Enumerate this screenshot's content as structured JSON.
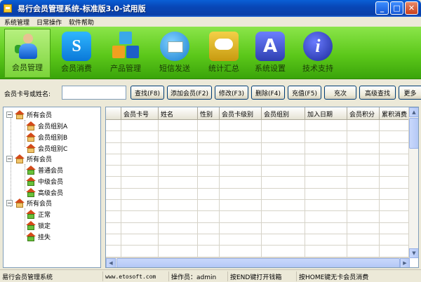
{
  "window": {
    "title": "易行会员管理系统-标准版3.0-试用版",
    "buttons": [
      "_",
      "□",
      "✕"
    ]
  },
  "menu": [
    "系统管理",
    "日常操作",
    "软件帮助"
  ],
  "toolbar": [
    {
      "label": "会员管理",
      "icon": "members-icon"
    },
    {
      "label": "会员消费",
      "icon": "skype-icon"
    },
    {
      "label": "产品管理",
      "icon": "product-blocks-icon"
    },
    {
      "label": "短信发送",
      "icon": "mail-icon"
    },
    {
      "label": "统计汇总",
      "icon": "chat-bubble-icon"
    },
    {
      "label": "系统设置",
      "icon": "app-store-icon"
    },
    {
      "label": "技术支持",
      "icon": "info-icon"
    }
  ],
  "search": {
    "label": "会员卡号或姓名:",
    "value": "",
    "buttons": [
      "查找(F8)",
      "添加会员(F2)",
      "修改(F3)",
      "删除(F4)",
      "充值(F5)",
      "充次",
      "高级查找",
      "更多"
    ]
  },
  "tree": {
    "groups": [
      {
        "label": "所有会员",
        "children": [
          "会员组别A",
          "会员组别B",
          "会员组别C"
        ]
      },
      {
        "label": "所有会员",
        "children": [
          "普通会员",
          "中级会员",
          "高级会员"
        ]
      },
      {
        "label": "所有会员",
        "children": [
          "正常",
          "锁定",
          "挂失"
        ]
      }
    ]
  },
  "grid": {
    "columns": [
      "",
      "会员卡号",
      "姓名",
      "性别",
      "会员卡级别",
      "会员组别",
      "加入日期",
      "会员积分",
      "累积消费"
    ]
  },
  "status": {
    "app": "易行会员管理系统",
    "site": "www.etosoft.com",
    "operator": "操作员：admin",
    "hint1": "按END键打开钱箱",
    "hint2": "按HOME键无卡会员消费"
  }
}
